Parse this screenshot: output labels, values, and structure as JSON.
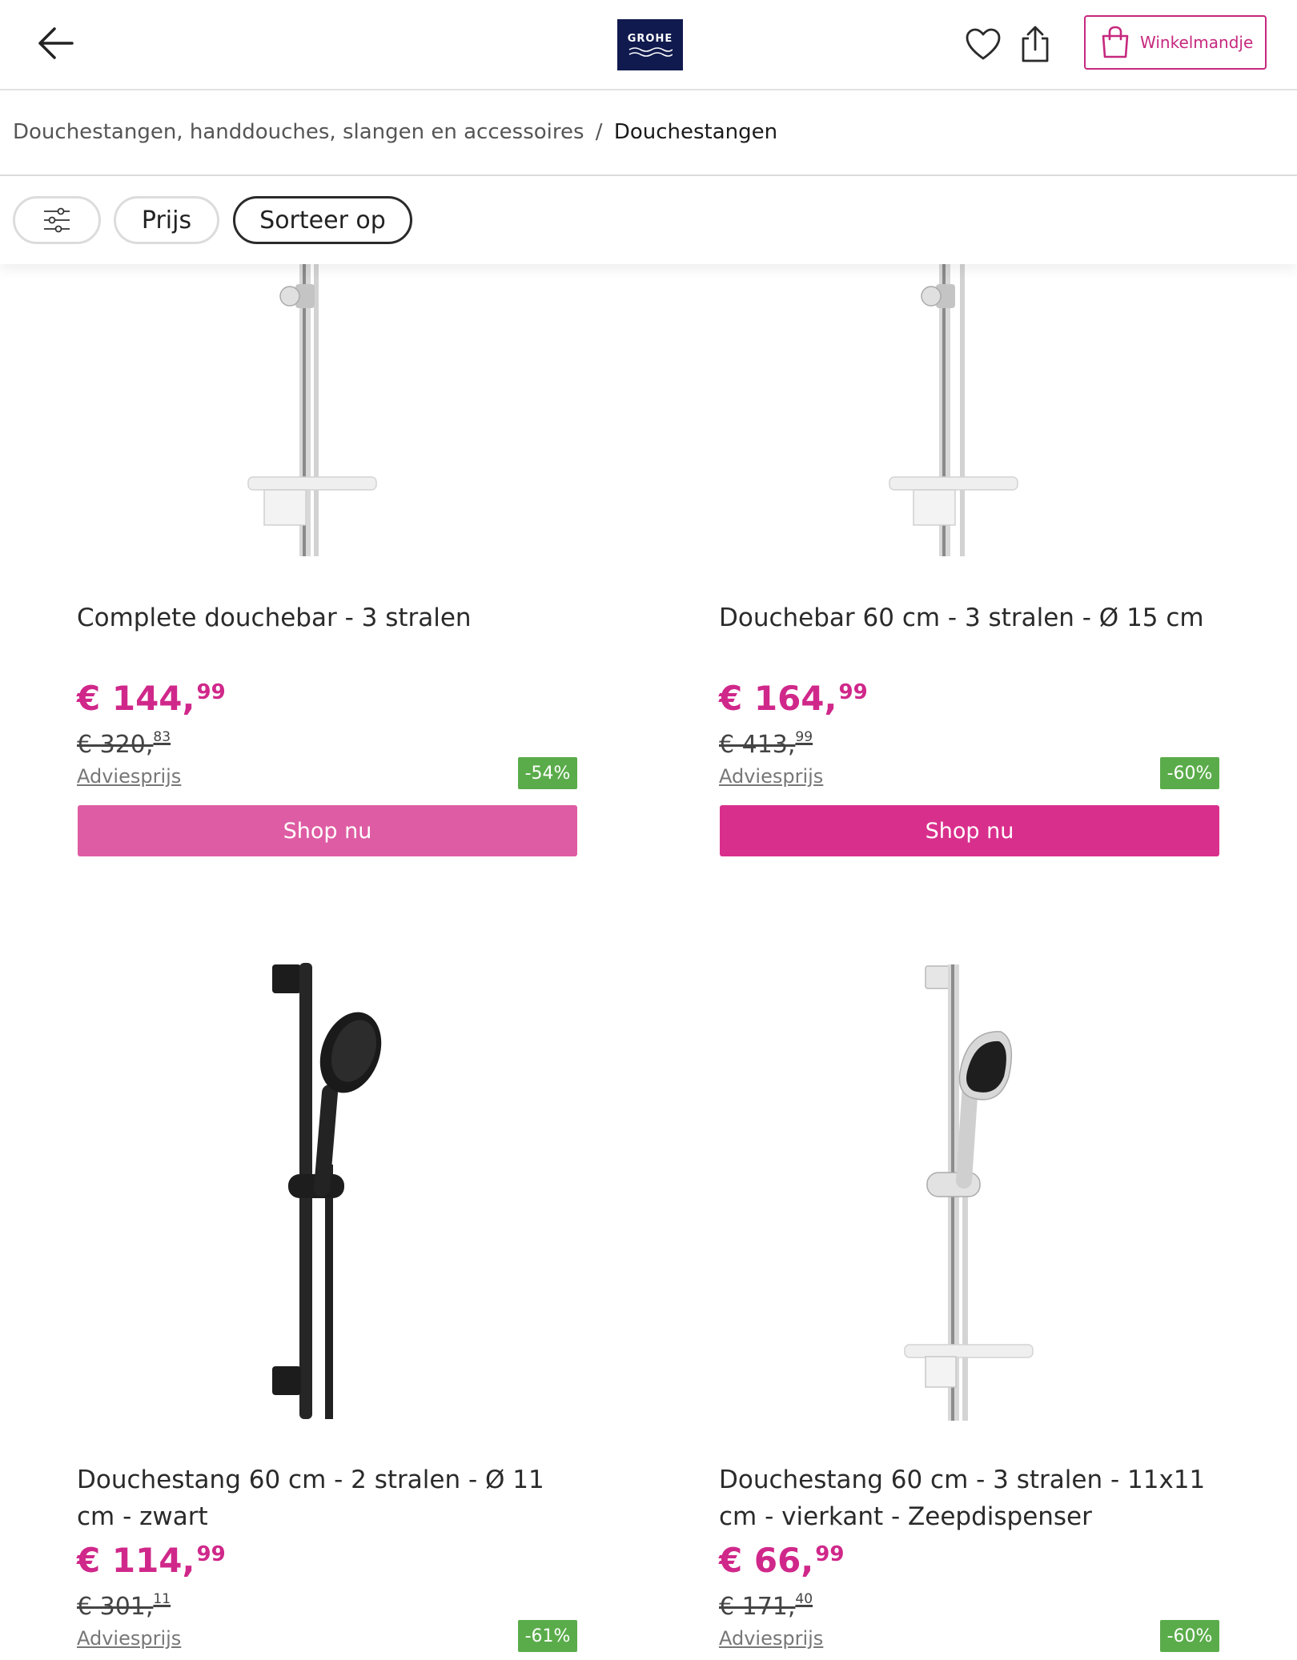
{
  "header": {
    "logo_text": "GROHE",
    "cart_label": "Winkelmandje"
  },
  "breadcrumb": {
    "parent": "Douchestangen, handdouches, slangen en accessoires",
    "separator": "/",
    "current": "Douchestangen"
  },
  "filters": {
    "price_label": "Prijs",
    "sort_label": "Sorteer op"
  },
  "colors": {
    "brand_pink": "#d0288a",
    "button_pink_light": "#de5ca3",
    "button_pink": "#d92f8c",
    "discount_green": "#5aac4a",
    "logo_navy": "#101a4e"
  },
  "products": [
    {
      "title": "Complete douchebar - 3 stralen",
      "price_main": "€ 144,",
      "price_cents": "99",
      "old_price_main": "€ 320,",
      "old_price_cents": "83",
      "advies_label": "Adviesprijs",
      "discount": "-54%",
      "button_label": "Shop nu",
      "finish": "chrome"
    },
    {
      "title": "Douchebar 60 cm - 3 stralen - Ø 15 cm",
      "price_main": "€ 164,",
      "price_cents": "99",
      "old_price_main": "€ 413,",
      "old_price_cents": "99",
      "advies_label": "Adviesprijs",
      "discount": "-60%",
      "button_label": "Shop nu",
      "finish": "chrome"
    },
    {
      "title": "Douchestang 60 cm - 2 stralen - Ø 11 cm - zwart",
      "price_main": "€ 114,",
      "price_cents": "99",
      "old_price_main": "€ 301,",
      "old_price_cents": "11",
      "advies_label": "Adviesprijs",
      "discount": "-61%",
      "finish": "matte-black"
    },
    {
      "title": "Douchestang 60 cm - 3 stralen - 11x11 cm - vierkant - Zeepdispenser",
      "price_main": "€ 66,",
      "price_cents": "99",
      "old_price_main": "€ 171,",
      "old_price_cents": "40",
      "advies_label": "Adviesprijs",
      "discount": "-60%",
      "finish": "chrome"
    }
  ]
}
